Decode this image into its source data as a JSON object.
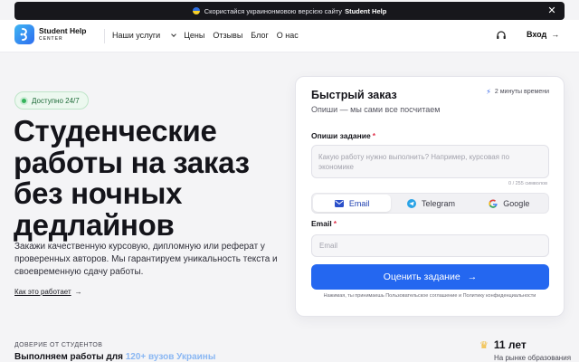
{
  "banner": {
    "text": "Скористайся украинонмовою версією сайту",
    "brand": "Student Help"
  },
  "header": {
    "logo_title": "Student Help",
    "logo_sub": "CENTER",
    "nav": [
      "Наши услуги",
      "Цены",
      "Отзывы",
      "Блог",
      "О нас"
    ],
    "login": "Вход",
    "login_arrow": "→"
  },
  "hero": {
    "badge": "Доступно 24/7",
    "title_lines": [
      "Студенческие",
      "работы на заказ",
      "без ночных",
      "дедлайнов"
    ],
    "description": "Закажи качественную курсовую, дипломную или реферат у проверенных авторов. Мы гарантируем уникальность текста и своевременную сдачу работы.",
    "how_link": "Как это работает",
    "how_arrow": "→"
  },
  "trust": {
    "label": "ДОВЕРИЕ ОТ СТУДЕНТОВ",
    "text_prefix": "Выполняем работы для",
    "text_highlight": "120+ вузов Украины",
    "years": "11 лет",
    "years_sub": "На рынке образования"
  },
  "form": {
    "title": "Быстрый заказ",
    "subtitle": "Опиши — мы сами все посчитаем",
    "time_note": "2 минуты времени",
    "task_label": "Опиши задание",
    "required_mark": "*",
    "task_placeholder": "Какую работу нужно выполнить? Например, курсовая по экономике",
    "counter": "0 / 255 символов",
    "contact_options": [
      "Email",
      "Telegram",
      "Google"
    ],
    "selected_contact": "Email",
    "email_label": "Email",
    "email_placeholder": "Email",
    "submit_label": "Оценить задание",
    "submit_arrow": "→",
    "legal": "Нажимая, ты принимаешь Пользовательское соглашение и Политику конфиденциальности"
  },
  "colors": {
    "primary": "#2467f0",
    "banner_bg": "#17171c",
    "badge_green": "#34b45b",
    "highlight": "#8ab7f3",
    "crown": "#f1b62a"
  },
  "icons": [
    "ukraine-flag-icon",
    "close-icon",
    "logo-icon",
    "chevron-down-icon",
    "headset-icon",
    "arrow-right-icon",
    "bolt-icon",
    "email-icon",
    "telegram-icon",
    "google-icon",
    "crown-icon"
  ]
}
